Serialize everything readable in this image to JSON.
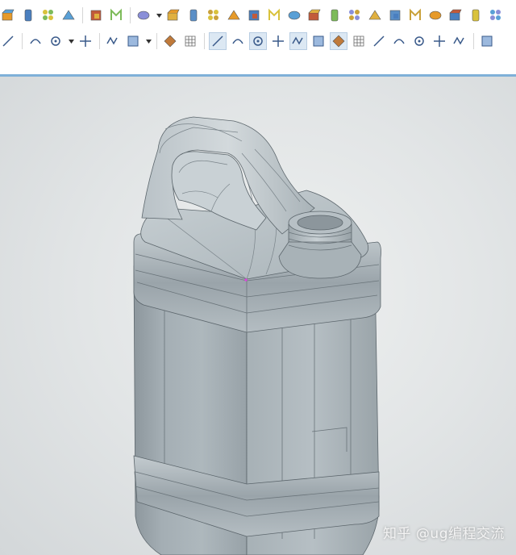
{
  "toolbar": {
    "row1_icons": [
      "extrude-icon",
      "cylinder-icon",
      "sketch-icon",
      "block-array-icon",
      "pattern-icon",
      "unite-icon",
      "datum-point-icon",
      "mirror-icon",
      "boolean-icon",
      "shell-icon",
      "draft-icon",
      "rotate-icon",
      "thicken-icon",
      "offset-face-icon",
      "trim-body-icon",
      "box-icon",
      "cone-icon",
      "bridge-surface-icon",
      "face-blend-icon",
      "sweep-icon",
      "solid-cube-icon",
      "split-body-icon",
      "sphere-icon",
      "curve-tool-icon"
    ],
    "row2_icons": [
      "undo-icon",
      "snap-icon",
      "select-box-icon",
      "redo-icon",
      "point-set-icon",
      "rectangle-select-icon",
      "shaded-view-icon",
      "solid-view-icon",
      "snap-grid-icon",
      "line-icon",
      "line-angle-icon",
      "arc-icon",
      "spline-icon",
      "curve-icon",
      "intersect-point-icon",
      "center-point-icon",
      "circle-point-icon",
      "plus-point-icon",
      "slash-icon",
      "measure-icon",
      "diamond-icon",
      "mesh-icon"
    ],
    "accent": "#7fb0d8"
  },
  "viewport": {
    "model": "plastic-jerrycan-3d-model",
    "background": "#e2e5e6",
    "model_color": "#a9b4ba"
  },
  "watermark": {
    "text": "知乎 @ug编程交流"
  }
}
